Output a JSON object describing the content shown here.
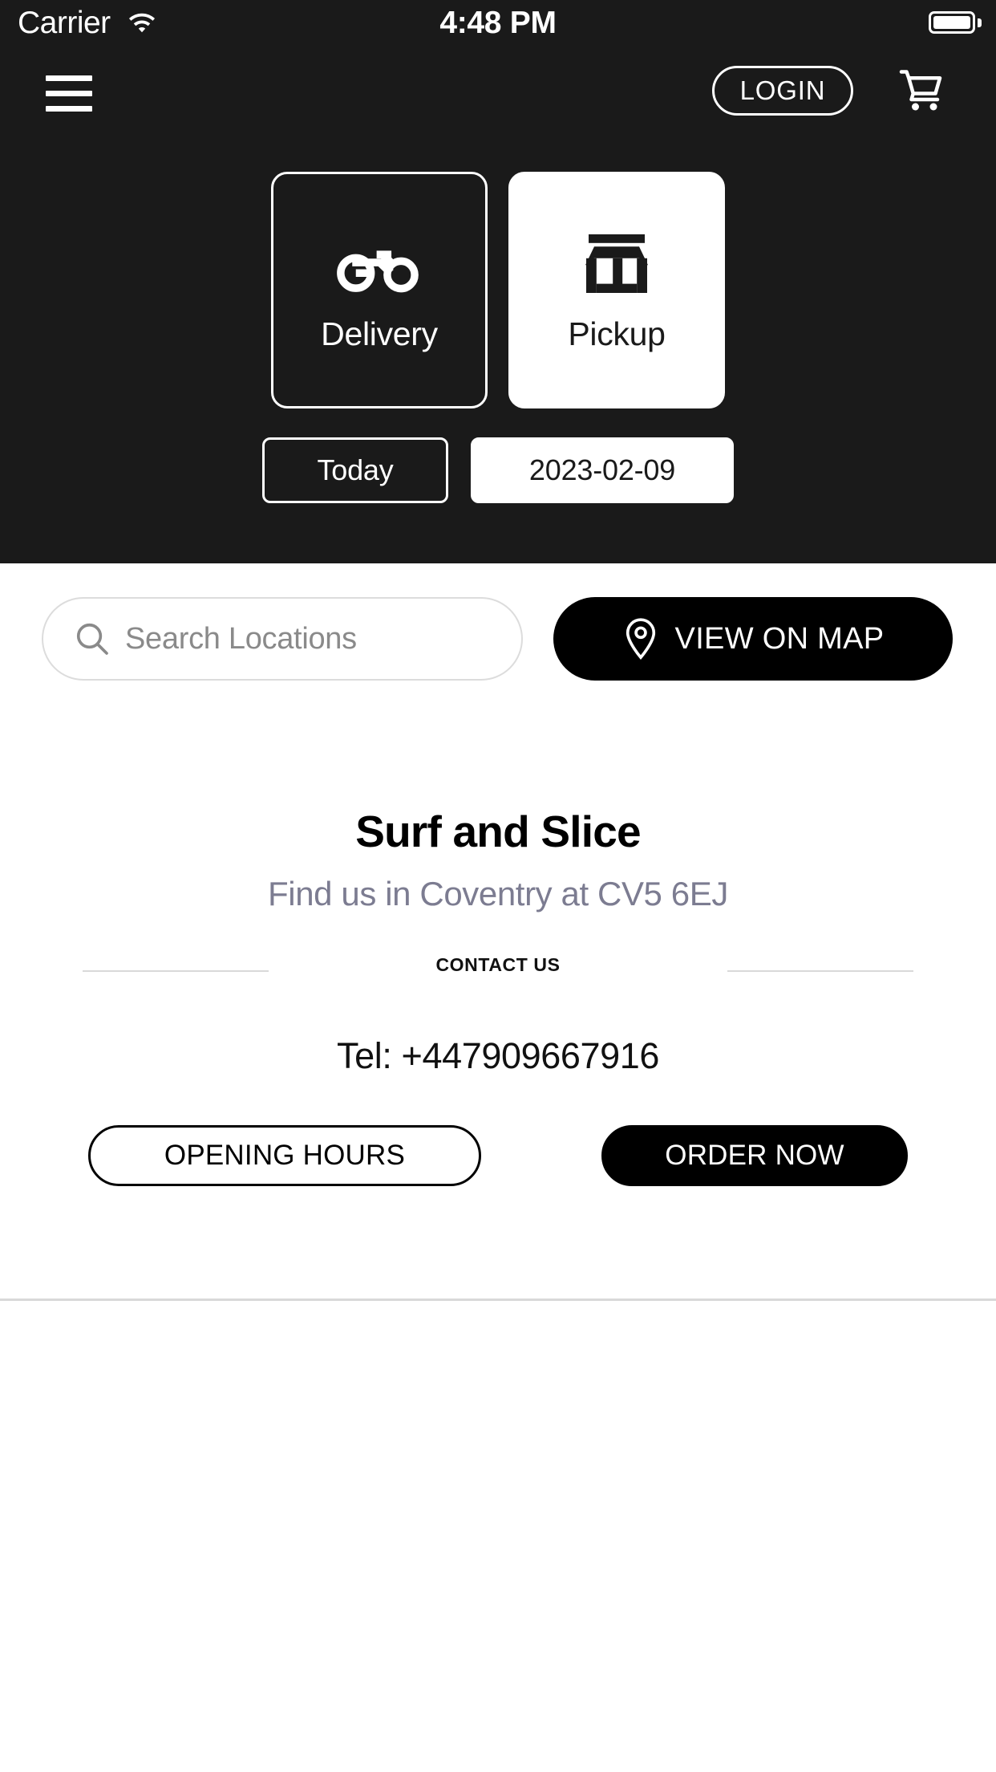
{
  "status_bar": {
    "carrier": "Carrier",
    "time": "4:48 PM",
    "wifi_icon": "wifi-icon",
    "battery_icon": "battery-full-icon"
  },
  "nav": {
    "menu_icon": "hamburger-menu-icon",
    "login_label": "LOGIN",
    "cart_icon": "shopping-cart-icon"
  },
  "order_mode": {
    "selected": "Pickup",
    "options": [
      {
        "label": "Delivery",
        "icon": "motorbike-icon",
        "selected": false
      },
      {
        "label": "Pickup",
        "icon": "storefront-icon",
        "selected": true
      }
    ]
  },
  "schedule": {
    "day_label": "Today",
    "date_value": "2023-02-09",
    "day_selected": false,
    "date_selected": true
  },
  "search": {
    "placeholder": "Search Locations",
    "value": "",
    "icon": "search-icon"
  },
  "map_button": {
    "label": "VIEW ON MAP",
    "icon": "map-pin-icon"
  },
  "store": {
    "name": "Surf and Slice",
    "address": "Find us in Coventry at CV5 6EJ",
    "contact_heading": "CONTACT US",
    "telephone": "Tel: +447909667916",
    "opening_hours_label": "OPENING HOURS",
    "order_now_label": "ORDER NOW"
  },
  "colors": {
    "header_bg": "#1a1a1a",
    "page_bg": "#ffffff",
    "accent": "#000000",
    "muted_text": "#7c7c91",
    "divider": "#d9d9d9",
    "placeholder": "#8a8a8a"
  }
}
